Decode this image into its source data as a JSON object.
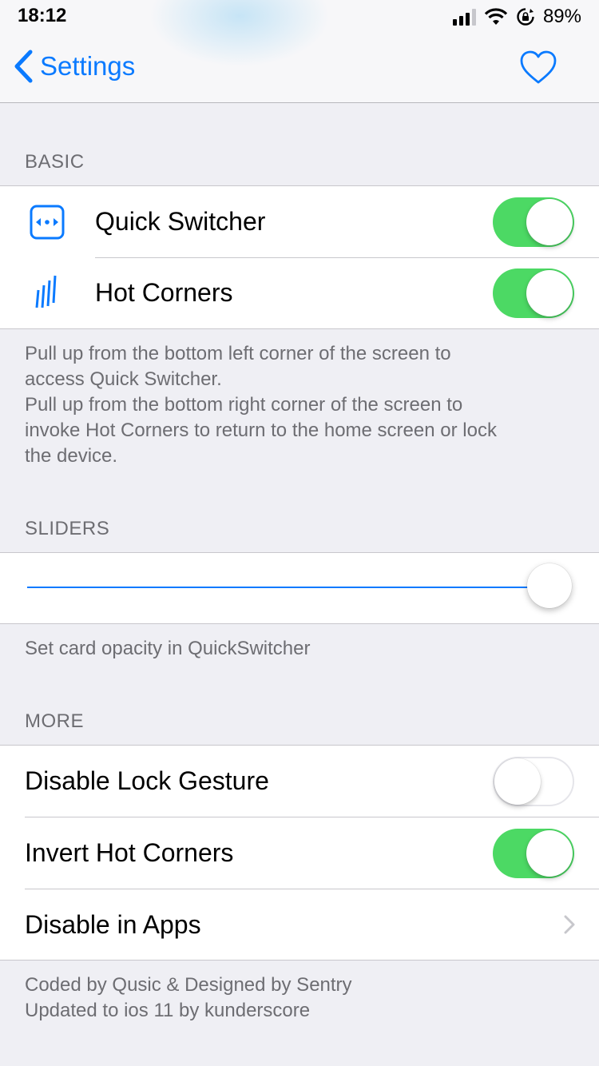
{
  "status_bar": {
    "time": "18:12",
    "battery": "89%"
  },
  "nav": {
    "back_label": "Settings",
    "back_icon": "chevron-left-icon",
    "favorite_icon": "heart-icon",
    "accent": "#0a7aff"
  },
  "basic": {
    "header": "BASIC",
    "items": [
      {
        "label": "Quick Switcher",
        "icon": "quick-switcher-icon",
        "on": true
      },
      {
        "label": "Hot Corners",
        "icon": "hot-corners-icon",
        "on": true
      }
    ],
    "footer_line1": "Pull up from the bottom left corner of the screen to",
    "footer_line2": "access Quick Switcher.",
    "footer_line3": "Pull up from the bottom right corner of the screen to",
    "footer_line4": "invoke Hot Corners to return to the home screen or lock",
    "footer_line5": "the device."
  },
  "sliders": {
    "header": "SLIDERS",
    "opacity_value": 1.0,
    "footer": "Set card opacity in QuickSwitcher"
  },
  "more": {
    "header": "MORE",
    "items": [
      {
        "label": "Disable Lock Gesture",
        "on": false
      },
      {
        "label": "Invert Hot Corners",
        "on": true
      },
      {
        "label": "Disable in Apps",
        "disclosure": true
      }
    ],
    "credits_line1": "Coded by Qusic & Designed by Sentry",
    "credits_line2": "Updated to ios 11 by kunderscore"
  },
  "colors": {
    "toggle_on": "#4cd964",
    "tint": "#0a7aff",
    "background": "#efeff4"
  }
}
